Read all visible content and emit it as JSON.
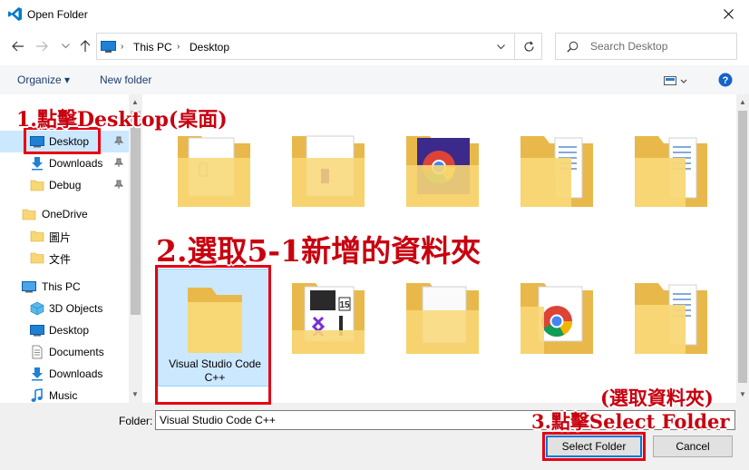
{
  "window": {
    "title": "Open Folder",
    "close_label": "✕"
  },
  "address": {
    "crumbs": [
      "This PC",
      "Desktop"
    ],
    "search_placeholder": "Search Desktop"
  },
  "toolbar": {
    "organize": "Organize ▾",
    "new_folder": "New folder"
  },
  "nav": {
    "items": [
      {
        "label": "Desktop"
      },
      {
        "label": "Downloads"
      },
      {
        "label": "Debug"
      },
      {
        "label": "OneDrive"
      },
      {
        "label": "圖片"
      },
      {
        "label": "文件"
      },
      {
        "label": "This PC"
      },
      {
        "label": "3D Objects"
      },
      {
        "label": "Desktop"
      },
      {
        "label": "Documents"
      },
      {
        "label": "Downloads"
      },
      {
        "label": "Music"
      }
    ]
  },
  "content": {
    "selected_folder_line1": "Visual Studio Code",
    "selected_folder_line2": "C++"
  },
  "footer": {
    "folder_label": "Folder:",
    "folder_value": "Visual Studio Code C++",
    "select_button": "Select Folder",
    "cancel_button": "Cancel"
  },
  "annotations": {
    "step1": "1.點擊Desktop(桌面)",
    "step2": "2.選取5-1新增的資料夾",
    "step3_note": "(選取資料夾)",
    "step3": "3.點擊Select Folder"
  },
  "colors": {
    "accent": "#0078d7",
    "selection": "#cce8ff",
    "annotation": "#e60012",
    "folder": "#f8d775"
  }
}
